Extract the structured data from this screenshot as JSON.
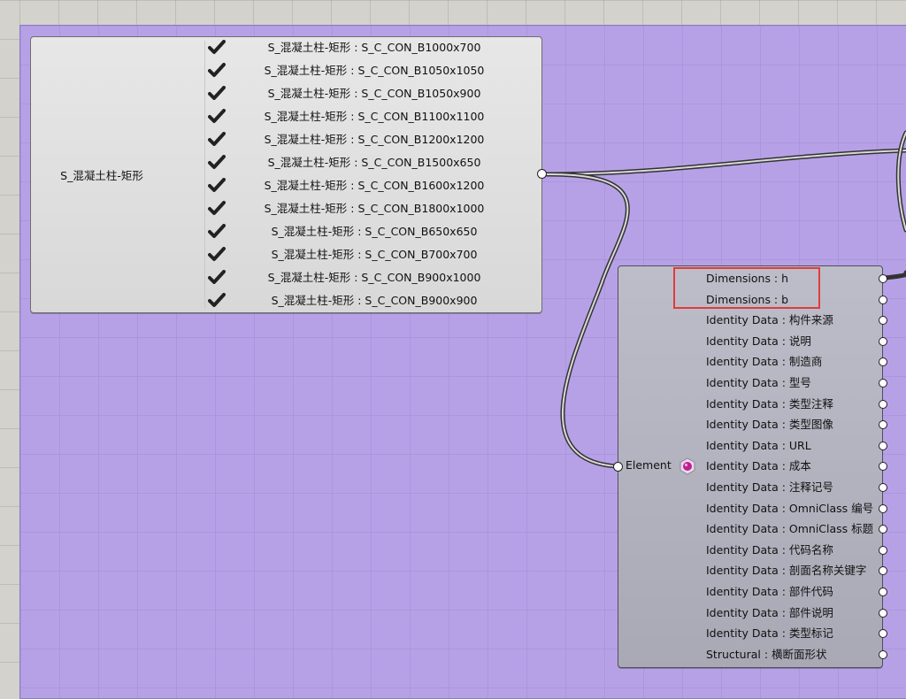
{
  "value_list": {
    "name": "S_混凝土柱-矩形",
    "items": [
      {
        "label": "S_混凝土柱-矩形 : S_C_CON_B1000x700",
        "checked": true
      },
      {
        "label": "S_混凝土柱-矩形 : S_C_CON_B1050x1050",
        "checked": true
      },
      {
        "label": "S_混凝土柱-矩形 : S_C_CON_B1050x900",
        "checked": true
      },
      {
        "label": "S_混凝土柱-矩形 : S_C_CON_B1100x1100",
        "checked": true
      },
      {
        "label": "S_混凝土柱-矩形 : S_C_CON_B1200x1200",
        "checked": true
      },
      {
        "label": "S_混凝土柱-矩形 : S_C_CON_B1500x650",
        "checked": true
      },
      {
        "label": "S_混凝土柱-矩形 : S_C_CON_B1600x1200",
        "checked": true
      },
      {
        "label": "S_混凝土柱-矩形 : S_C_CON_B1800x1000",
        "checked": true
      },
      {
        "label": "S_混凝土柱-矩形 : S_C_CON_B650x650",
        "checked": true
      },
      {
        "label": "S_混凝土柱-矩形 : S_C_CON_B700x700",
        "checked": true
      },
      {
        "label": "S_混凝土柱-矩形 : S_C_CON_B900x1000",
        "checked": true
      },
      {
        "label": "S_混凝土柱-矩形 : S_C_CON_B900x900",
        "checked": true
      }
    ]
  },
  "element_component": {
    "input_label": "Element",
    "outputs": [
      "Dimensions : h",
      "Dimensions : b",
      "Identity Data : 构件来源",
      "Identity Data : 说明",
      "Identity Data : 制造商",
      "Identity Data : 型号",
      "Identity Data : 类型注释",
      "Identity Data : 类型图像",
      "Identity Data : URL",
      "Identity Data : 成本",
      "Identity Data : 注释记号",
      "Identity Data : OmniClass 编号",
      "Identity Data : OmniClass 标题",
      "Identity Data : 代码名称",
      "Identity Data : 剖面名称关键字",
      "Identity Data : 部件代码",
      "Identity Data : 部件说明",
      "Identity Data : 类型标记",
      "Structural : 横断面形状"
    ]
  },
  "colors": {
    "group_fill": "#b7a1e6",
    "canvas_bg": "#d3d2cd",
    "highlight": "#e23b3b",
    "icon_accent": "#c0208f"
  }
}
